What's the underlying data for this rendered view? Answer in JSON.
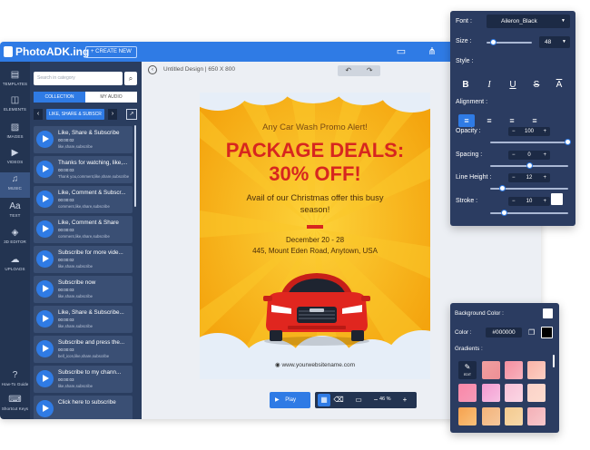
{
  "app": {
    "logo": "PhotoADK.ing",
    "create_button": "+ CREATE NEW",
    "design_title": "Untitled Design | 650 X 800"
  },
  "left_rail": [
    {
      "label": "TEMPLATES",
      "icon": "templates-icon",
      "glyph": "▤"
    },
    {
      "label": "ELEMENTS",
      "icon": "elements-icon",
      "glyph": "◫"
    },
    {
      "label": "IMAGES",
      "icon": "image-icon",
      "glyph": "▨"
    },
    {
      "label": "VIDEOS",
      "icon": "video-icon",
      "glyph": "▶"
    },
    {
      "label": "MUSIC",
      "icon": "music-icon",
      "glyph": "♫"
    },
    {
      "label": "TEXT",
      "icon": "text-icon",
      "glyph": "Aa"
    },
    {
      "label": "3D EDITOR",
      "icon": "cube-icon",
      "glyph": "◈"
    },
    {
      "label": "UPLOADS",
      "icon": "upload-cloud-icon",
      "glyph": "☁"
    },
    {
      "label": "How-To Guide",
      "icon": "help-icon",
      "glyph": "?"
    },
    {
      "label": "Shortcut Keys",
      "icon": "keyboard-icon",
      "glyph": "⌨"
    }
  ],
  "panel": {
    "search_placeholder": "Search in category",
    "tabs": [
      "COLLECTION",
      "MY AUDIO"
    ],
    "category": "LIKE, SHARE & SUBSCR",
    "items": [
      {
        "title": "Like, Share & Subscribe",
        "duration": "00:00:02",
        "tags": "like,share,subscribe"
      },
      {
        "title": "Thanks for watching, like,...",
        "duration": "00:00:03",
        "tags": "Thank you,comment,like,share,subscribe"
      },
      {
        "title": "Like, Comment & Subscr...",
        "duration": "00:00:03",
        "tags": "comment,like,share,subscribe"
      },
      {
        "title": "Like, Comment & Share",
        "duration": "00:00:03",
        "tags": "comment,like,share,subscribe"
      },
      {
        "title": "Subscribe for more vide...",
        "duration": "00:00:02",
        "tags": "like,share,subscribe"
      },
      {
        "title": "Subscribe now",
        "duration": "00:00:03",
        "tags": "like,share,subscribe"
      },
      {
        "title": "Like, Share & Subscribe...",
        "duration": "00:00:03",
        "tags": "like,share,subscribe"
      },
      {
        "title": "Subscribe and press the...",
        "duration": "00:00:03",
        "tags": "bell_icon,like,share,subscribe"
      },
      {
        "title": "Subscribe to my chann...",
        "duration": "00:00:03",
        "tags": "like,share,subscribe"
      },
      {
        "title": "Click here to subscribe",
        "duration": "",
        "tags": ""
      }
    ]
  },
  "poster": {
    "headline": "Any Car Wash Promo Alert!",
    "title_line1": "PACKAGE DEALS:",
    "title_line2": "30% OFF!",
    "subtitle": "Avail of our Christmas offer this busy season!",
    "date": "December 20 - 28",
    "address": "445, Mount Eden Road, Anytown, USA",
    "url": "www.yourwebsitename.com",
    "colors": {
      "background": "#f9b916",
      "title": "#d7261f",
      "car": "#d7261f"
    }
  },
  "bottom_toolbar": {
    "play": "Play",
    "zoom": "46 %"
  },
  "text_panel": {
    "font_label": "Font :",
    "font_value": "Aileron_Black",
    "size_label": "Size :",
    "size_value": "48",
    "style_label": "Style :",
    "alignment_label": "Alignment :",
    "opacity_label": "Opacity :",
    "opacity_value": "100",
    "spacing_label": "Spacing :",
    "spacing_value": "0",
    "line_height_label": "Line Height :",
    "line_height_value": "12",
    "stroke_label": "Stroke :",
    "stroke_value": "10",
    "stroke_color": "#ffffff"
  },
  "bg_panel": {
    "title": "Background Color :",
    "color_label": "Color :",
    "color_value": "#000000",
    "gradients_label": "Gradients :",
    "edit_label": "EDIT",
    "gradients": [
      [
        "#f0a0a0",
        "#ee8f96"
      ],
      [
        "#f58fa0",
        "#f7b2bd"
      ],
      [
        "#fab3a8",
        "#fbcfc3"
      ],
      [
        "#fa88a8",
        "#f59ab8"
      ],
      [
        "#f49ad0",
        "#f7bfe2"
      ],
      [
        "#f8c0d6",
        "#fbd6e4"
      ],
      [
        "#fbd2c8",
        "#fcdccf"
      ],
      [
        "#f6a24f",
        "#f8c07a"
      ],
      [
        "#f4b37a",
        "#f5c79b"
      ],
      [
        "#f4ca8f",
        "#f7d8a9"
      ],
      [
        "#f4b0b7",
        "#f7c7cb"
      ]
    ]
  }
}
